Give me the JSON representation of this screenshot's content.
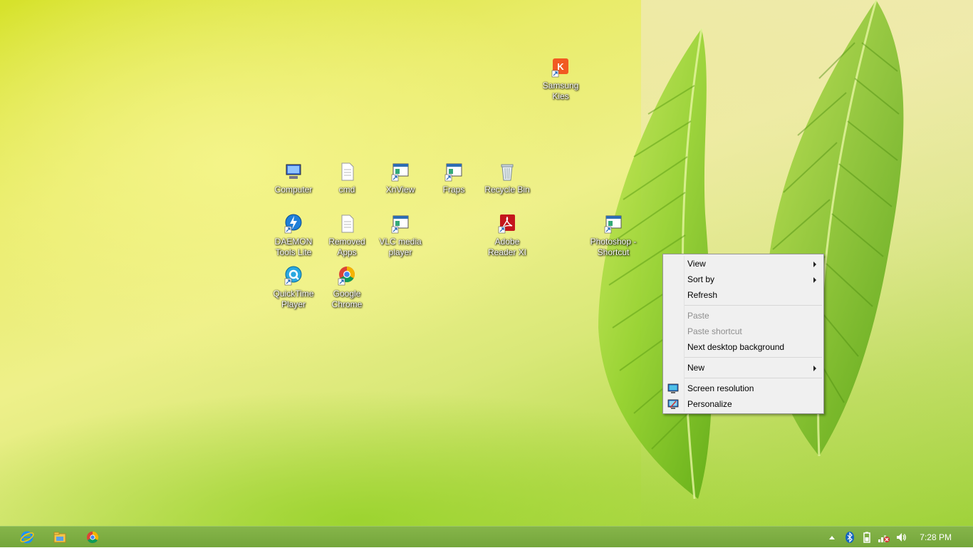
{
  "desktop": {
    "icons": [
      {
        "label": "Samsung Kies"
      },
      {
        "label": "Computer"
      },
      {
        "label": "cmd"
      },
      {
        "label": "XnView"
      },
      {
        "label": "Fraps"
      },
      {
        "label": "Recycle Bin"
      },
      {
        "label": "DAEMON Tools Lite"
      },
      {
        "label": "Removed Apps"
      },
      {
        "label": "VLC media player"
      },
      {
        "label": "Adobe Reader XI"
      },
      {
        "label": "Photoshop - Shortcut"
      },
      {
        "label": "QuickTime Player"
      },
      {
        "label": "Google Chrome"
      }
    ]
  },
  "context_menu": {
    "items": {
      "view": "View",
      "sort_by": "Sort by",
      "refresh": "Refresh",
      "paste": "Paste",
      "paste_shortcut": "Paste shortcut",
      "next_background": "Next desktop background",
      "new": "New",
      "screen_resolution": "Screen resolution",
      "personalize": "Personalize"
    }
  },
  "taskbar": {
    "pinned": [
      "internet-explorer-icon",
      "file-explorer-icon",
      "chrome-icon"
    ],
    "tray": [
      "show-hidden-icons-arrow",
      "bluetooth-icon",
      "power-icon",
      "network-icon",
      "volume-icon"
    ],
    "clock": "7:28 PM"
  },
  "colors": {
    "taskbar": "#7aad40",
    "menu_bg": "#f0f0f0"
  }
}
